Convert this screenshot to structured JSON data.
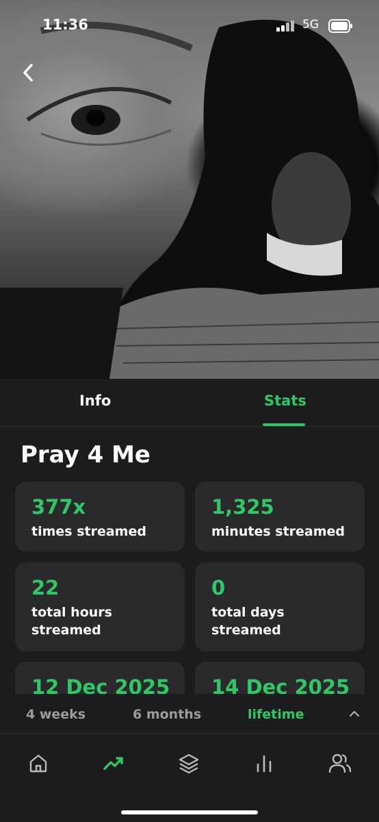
{
  "status_bar": {
    "time": "11:36",
    "network": "5G"
  },
  "hero": {
    "back_icon": "chevron-left-icon"
  },
  "tabs": [
    {
      "label": "Info",
      "active": false
    },
    {
      "label": "Stats",
      "active": true
    }
  ],
  "track": {
    "title": "Pray 4 Me"
  },
  "stats": [
    {
      "value": "377x",
      "label": "times streamed"
    },
    {
      "value": "1,325",
      "label": "minutes streamed"
    },
    {
      "value": "22",
      "label": "total hours streamed"
    },
    {
      "value": "0",
      "label": "total days streamed"
    },
    {
      "value": "12 Dec 2025",
      "label": ""
    },
    {
      "value": "14 Dec 2025",
      "label": ""
    }
  ],
  "periods": [
    {
      "label": "4 weeks",
      "active": false
    },
    {
      "label": "6 months",
      "active": false
    },
    {
      "label": "lifetime",
      "active": true
    }
  ],
  "nav": [
    {
      "icon": "home-icon",
      "active": false
    },
    {
      "icon": "trending-icon",
      "active": true
    },
    {
      "icon": "layers-icon",
      "active": false
    },
    {
      "icon": "bar-chart-icon",
      "active": false
    },
    {
      "icon": "friends-icon",
      "active": false
    }
  ],
  "colors": {
    "accent": "#2ec866",
    "background": "#1c1c1e",
    "card": "#2a2a2c",
    "muted": "#9c9c9c"
  }
}
